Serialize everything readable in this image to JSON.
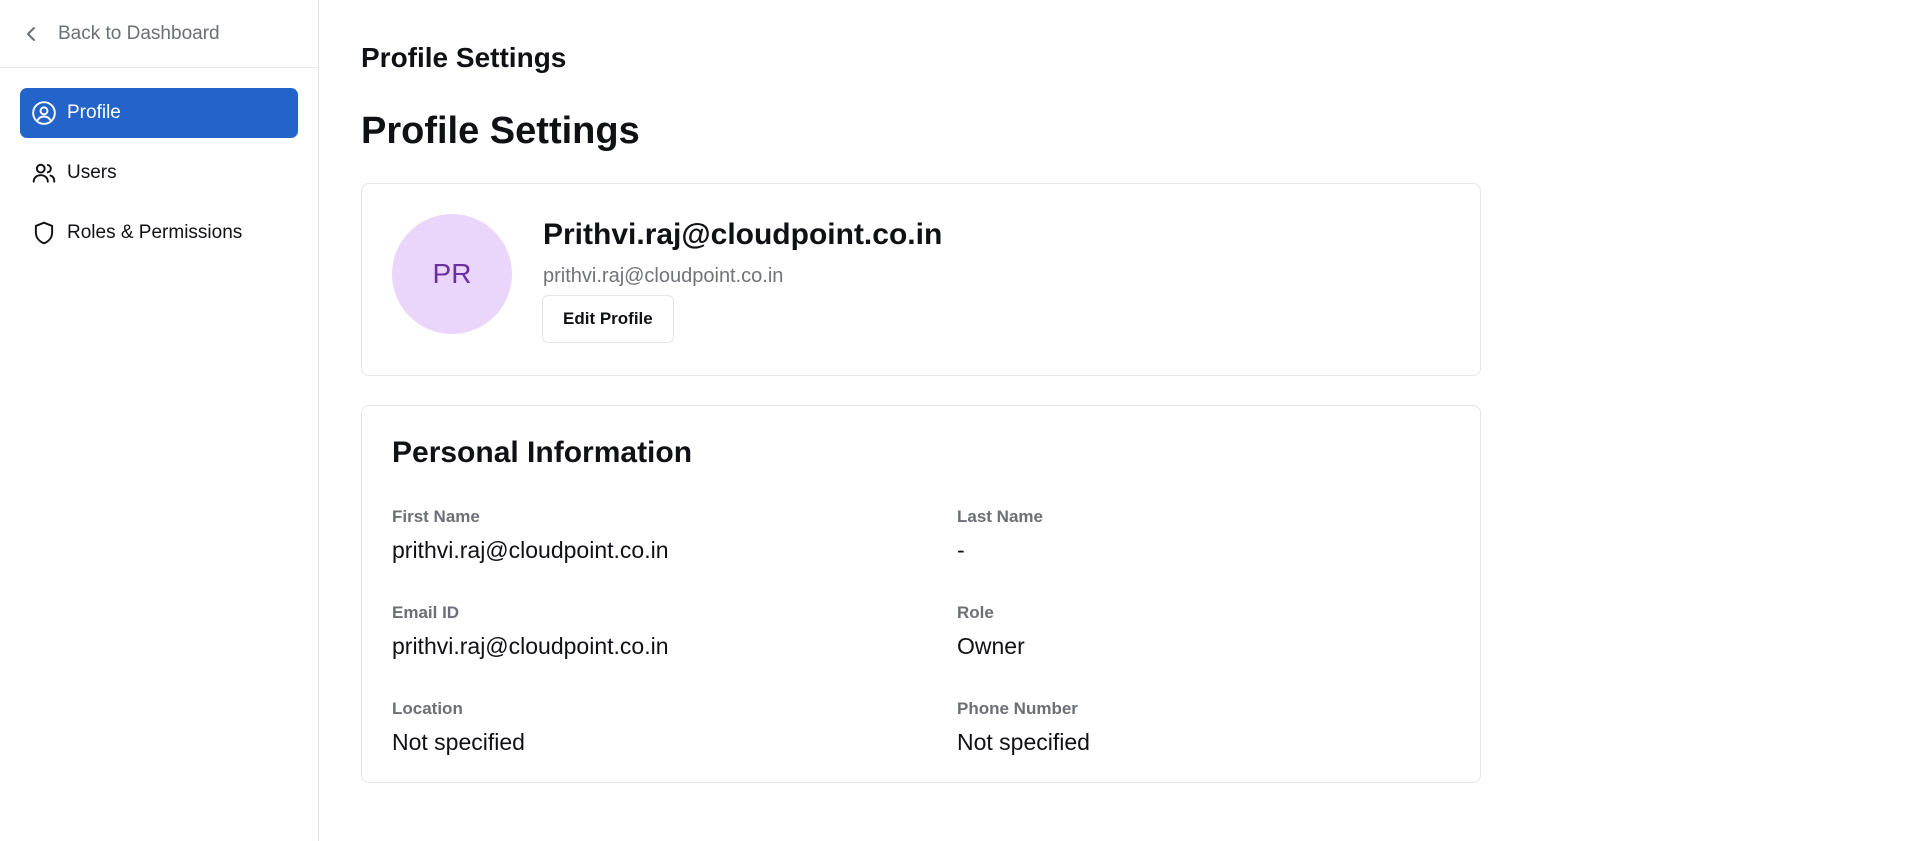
{
  "sidebar": {
    "back_label": "Back to Dashboard",
    "items": [
      {
        "label": "Profile",
        "icon": "user-circle-icon",
        "active": true
      },
      {
        "label": "Users",
        "icon": "users-icon",
        "active": false
      },
      {
        "label": "Roles & Permissions",
        "icon": "shield-icon",
        "active": false
      }
    ]
  },
  "header": {
    "heading": "Profile Settings",
    "title": "Profile Settings"
  },
  "profile": {
    "initials": "PR",
    "name": "Prithvi.raj@cloudpoint.co.in",
    "email": "prithvi.raj@cloudpoint.co.in",
    "edit_label": "Edit Profile"
  },
  "personal_info": {
    "title": "Personal Information",
    "fields": [
      {
        "label": "First Name",
        "value": "prithvi.raj@cloudpoint.co.in"
      },
      {
        "label": "Last Name",
        "value": "-"
      },
      {
        "label": "Email ID",
        "value": "prithvi.raj@cloudpoint.co.in"
      },
      {
        "label": "Role",
        "value": "Owner"
      },
      {
        "label": "Location",
        "value": "Not specified"
      },
      {
        "label": "Phone Number",
        "value": "Not specified"
      }
    ]
  },
  "colors": {
    "accent": "#2264c9",
    "avatar_bg": "#ead5fb",
    "avatar_text": "#6a2fa3"
  }
}
